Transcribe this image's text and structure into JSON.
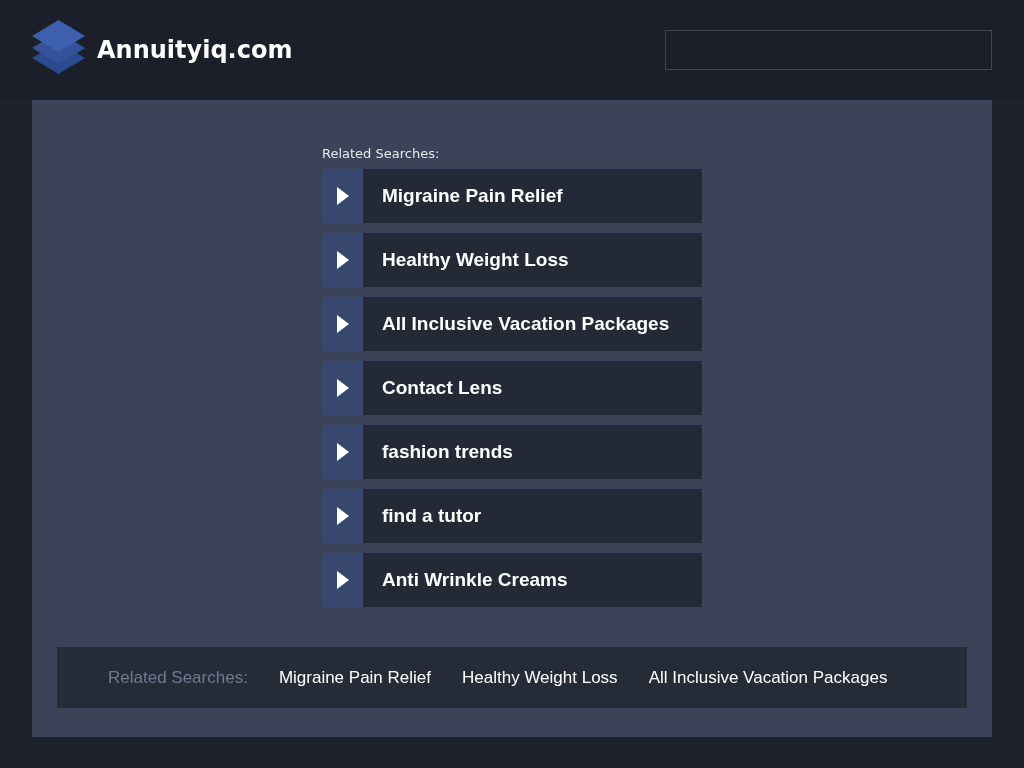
{
  "header": {
    "site_name": "Annuityiq.com"
  },
  "related": {
    "heading": "Related Searches:",
    "links": [
      {
        "label": "Migraine Pain Relief"
      },
      {
        "label": "Healthy Weight Loss"
      },
      {
        "label": "All Inclusive Vacation Packages"
      },
      {
        "label": "Contact Lens"
      },
      {
        "label": "fashion trends"
      },
      {
        "label": "find a tutor"
      },
      {
        "label": "Anti Wrinkle Creams"
      }
    ]
  },
  "footer": {
    "heading": "Related Searches:",
    "links": [
      {
        "label": "Migraine Pain Relief"
      },
      {
        "label": "Healthy Weight Loss"
      },
      {
        "label": "All Inclusive Vacation Packages"
      }
    ]
  }
}
